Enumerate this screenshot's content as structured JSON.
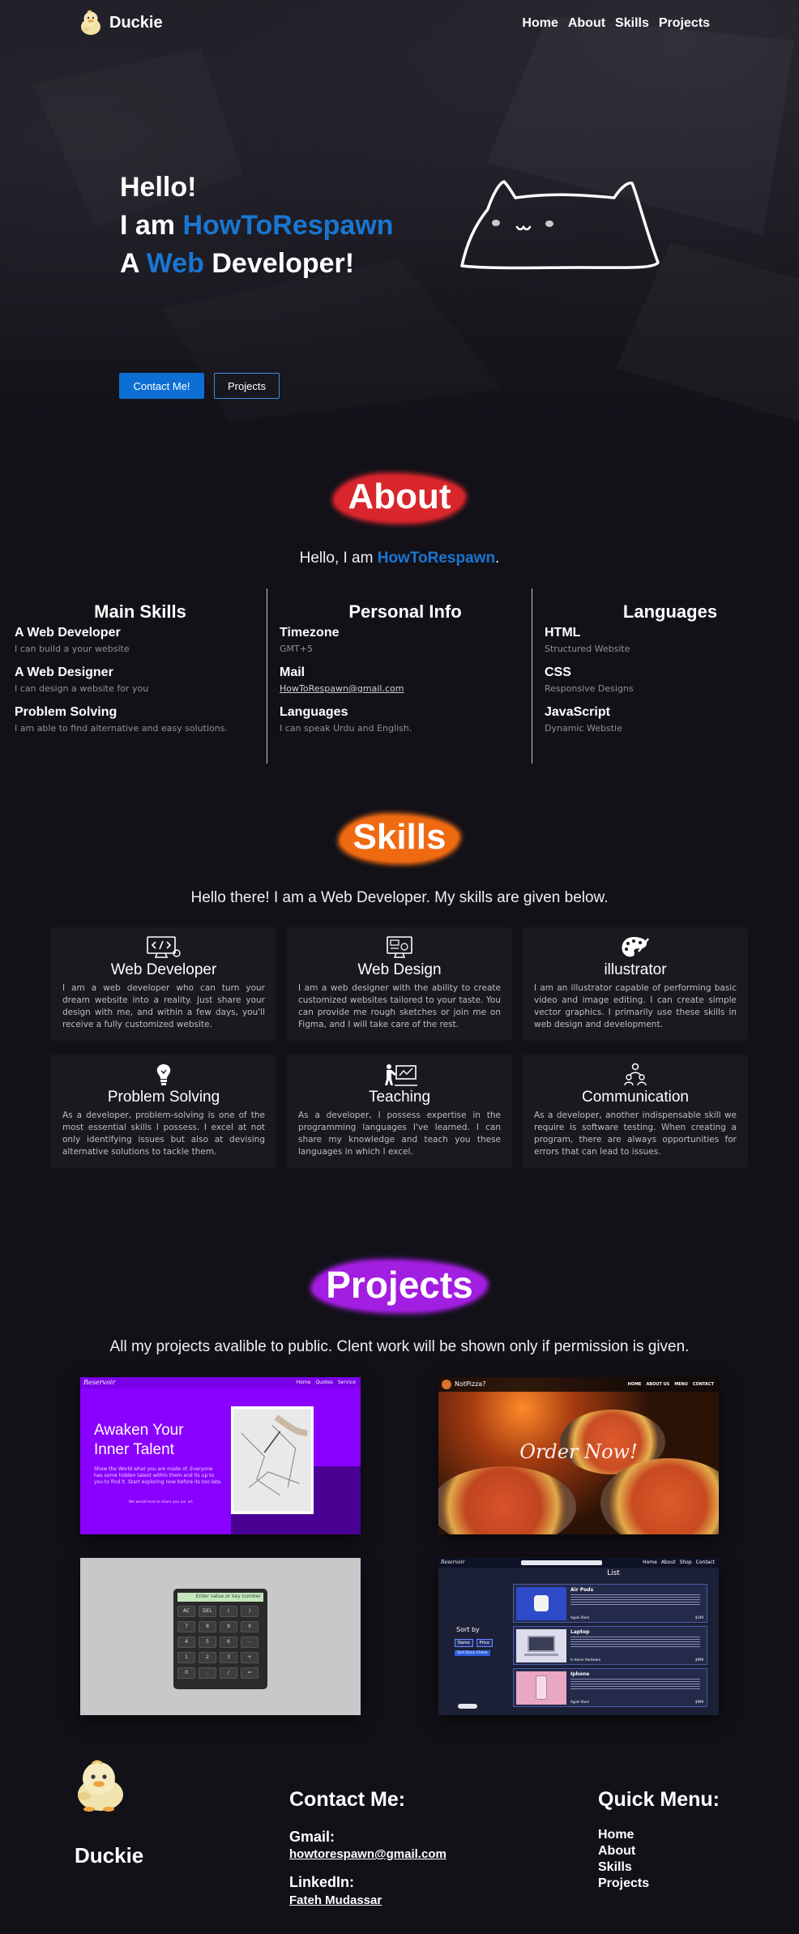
{
  "brand": {
    "name": "Duckie",
    "logo_icon": "duck-icon"
  },
  "nav": {
    "items": [
      "Home",
      "About",
      "Skills",
      "Projects"
    ]
  },
  "hero": {
    "line1": "Hello!",
    "line2_prefix": "I am ",
    "line2_name": "HowToRespawn",
    "line3_prefix": "A ",
    "line3_highlight": "Web",
    "line3_suffix": " Developer!",
    "illustration_icon": "cat-icon",
    "contact_button": "Contact Me!",
    "projects_button": "Projects",
    "accent_color": "#1976d2"
  },
  "about": {
    "title": "About",
    "intro_prefix": "Hello, I am ",
    "intro_name": "HowToRespawn",
    "intro_suffix": ".",
    "splash_color": "#d8262c",
    "columns": [
      {
        "heading": "Main Skills",
        "items": [
          {
            "k": "A Web Developer",
            "v": "I can build a your website"
          },
          {
            "k": "A Web Designer",
            "v": "I can design a website for you"
          },
          {
            "k": "Problem Solving",
            "v": "I am able to find alternative and easy solutions."
          }
        ]
      },
      {
        "heading": "Personal Info",
        "items": [
          {
            "k": "Timezone",
            "v": "GMT+5"
          },
          {
            "k": "Mail",
            "v": "HowToRespawn@gmail.com"
          },
          {
            "k": "Languages",
            "v": "I can speak Urdu and English."
          }
        ]
      },
      {
        "heading": "Languages",
        "items": [
          {
            "k": "HTML",
            "v": "Structured Website"
          },
          {
            "k": "CSS",
            "v": "Responsive Designs"
          },
          {
            "k": "JavaScript",
            "v": "Dynamic Webstie"
          }
        ]
      }
    ]
  },
  "skills": {
    "title": "Skills",
    "splash_color": "#f06a12",
    "intro": "Hello there! I am a Web Developer. My skills are given below.",
    "cards": [
      {
        "icon": "code-monitor-icon",
        "title": "Web Developer",
        "desc": "I am a web developer who can turn your dream website into a reality. Just share your design with me, and within a few days, you'll receive a fully customized website."
      },
      {
        "icon": "design-monitor-icon",
        "title": "Web Design",
        "desc": "I am a web designer with the ability to create customized websites tailored to your taste. You can provide me rough sketches or join me on Figma, and I will take care of the rest."
      },
      {
        "icon": "palette-icon",
        "title": "illustrator",
        "desc": "I am an illustrator capable of performing basic video and image editing. I can create simple vector graphics. I primarily use these skills in web design and development."
      },
      {
        "icon": "lightbulb-icon",
        "title": "Problem Solving",
        "desc": "As a developer, problem-solving is one of the most essential skills I possess. I excel at not only identifying issues but also at devising alternative solutions to tackle them."
      },
      {
        "icon": "teacher-icon",
        "title": "Teaching",
        "desc": "As a developer, I possess expertise in the programming languages I've learned. I can share my knowledge and teach you these languages in which I excel."
      },
      {
        "icon": "people-icon",
        "title": "Communication",
        "desc": "As a developer, another indispensable skill we require is software testing. When creating a program, there are always opportunities for errors that can lead to issues."
      }
    ]
  },
  "projects": {
    "title": "Projects",
    "splash_color": "#a21ee0",
    "intro": "All my projects avalible to public. Clent work will be shown only if permission is given.",
    "reservoir": {
      "logo": "Reservoir",
      "nav": [
        "Home",
        "Quotes",
        "Service"
      ],
      "headline1": "Awaken Your",
      "headline2": "Inner Talent",
      "body": "Show the World what you are made of. Everyone has some hidden talent within them and its up to you to find it. Start exploring now before its too late.",
      "footer_text": "We would love to share you our art"
    },
    "pizza": {
      "logo": "NotPizza?",
      "nav": [
        "HOME",
        "ABOUT US",
        "MENU",
        "CONTACT"
      ],
      "headline": "Order Now!"
    },
    "calculator": {
      "display_placeholder": "Enter value or key number",
      "keys": [
        "AC",
        "DEL",
        "(",
        ")",
        "7",
        "8",
        "9",
        "X",
        "4",
        "5",
        "6",
        "-",
        "1",
        "2",
        "3",
        "+",
        "0",
        ".",
        "/",
        "="
      ]
    },
    "shop": {
      "logo": "Reservoir",
      "nav": [
        "Home",
        "About",
        "Shop",
        "Contact"
      ],
      "list_title": "List",
      "sort_label": "Sort by",
      "sort_options": [
        "Name",
        "Price"
      ],
      "sort_button": "Sort Once Check",
      "items": [
        {
          "name": "Air Pods",
          "store": "Apple Store",
          "price": "$199"
        },
        {
          "name": "Laptop",
          "store": "Is Honor Hardware",
          "price": "$999"
        },
        {
          "name": "Iphone",
          "store": "Apple Store",
          "price": "$999"
        }
      ]
    }
  },
  "footer": {
    "brand": "Duckie",
    "contact_title": "Contact Me:",
    "gmail_label": "Gmail:",
    "gmail_value": "howtorespawn@gmail.com",
    "linkedin_label": "LinkedIn:",
    "linkedin_value": "Fateh Mudassar",
    "menu_title": "Quick Menu:",
    "menu_items": [
      "Home",
      "About",
      "Skills",
      "Projects"
    ]
  }
}
